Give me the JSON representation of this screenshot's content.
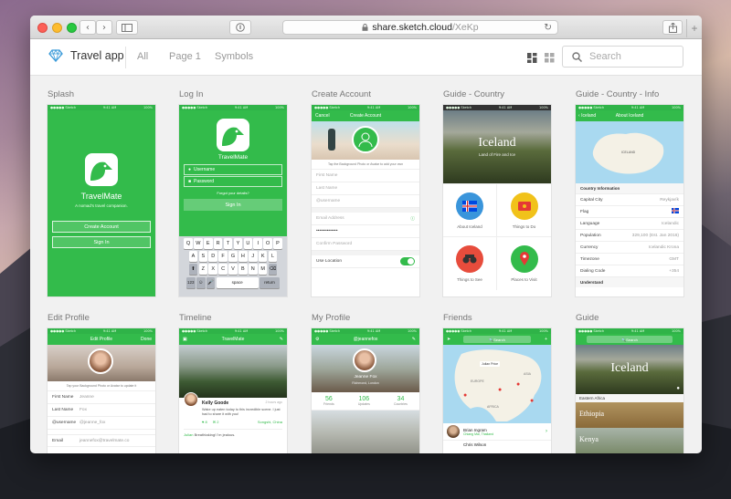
{
  "browser": {
    "url_host": "share.sketch.cloud",
    "url_path": "/XeKp",
    "back_icon": "chevron-left-icon",
    "forward_icon": "chevron-right-icon"
  },
  "app": {
    "title": "Travel app",
    "nav": [
      "All",
      "Page 1",
      "Symbols"
    ],
    "search_placeholder": "Search"
  },
  "artboards": {
    "splash": {
      "label": "Splash",
      "app_name": "TravelMate",
      "tagline": "A nomad's travel companion.",
      "create_account": "Create Account",
      "sign_in": "Sign In"
    },
    "login": {
      "label": "Log In",
      "app_name": "TravelMate",
      "username": "Username",
      "password": "Password",
      "forgot": "Forgot your details?",
      "sign_in": "Sign In",
      "kb_row1": [
        "Q",
        "W",
        "E",
        "R",
        "T",
        "Y",
        "U",
        "I",
        "O",
        "P"
      ],
      "kb_row2": [
        "A",
        "S",
        "D",
        "F",
        "G",
        "H",
        "J",
        "K",
        "L"
      ],
      "kb_row3": [
        "Z",
        "X",
        "C",
        "V",
        "B",
        "N",
        "M"
      ],
      "kb_123": "123",
      "kb_space": "space",
      "kb_return": "return"
    },
    "create": {
      "label": "Create Account",
      "cancel": "Cancel",
      "title": "Create Account",
      "hint": "Tap the Background Photo or Avatar to add your own",
      "first": "First Name",
      "last": "Last Name",
      "username": "@username",
      "email": "Email Address",
      "password": "••••••••••••••",
      "confirm": "Confirm Password",
      "location": "Use Location"
    },
    "guide_country": {
      "label": "Guide - Country",
      "title": "Iceland",
      "subtitle": "Land of Fire and Ice",
      "tiles": [
        "About Iceland",
        "Things to Do",
        "Things to See",
        "Places to Visit"
      ]
    },
    "guide_info": {
      "label": "Guide - Country - Info",
      "back": "Iceland",
      "title": "About Iceland",
      "map_label": "ICELAND",
      "section": "Country Information",
      "rows": [
        [
          "Capital City",
          "Reykjavík"
        ],
        [
          "Flag",
          ""
        ],
        [
          "Language",
          "Icelandic"
        ],
        [
          "Population",
          "329,100 (Est. Jan 2016)"
        ],
        [
          "Currency",
          "Icelandic Krona"
        ],
        [
          "Timezone",
          "GMT"
        ],
        [
          "Dialing Code",
          "+354"
        ]
      ],
      "footer": "Understand"
    },
    "edit_profile": {
      "label": "Edit Profile",
      "title": "Edit Profile",
      "done": "Done",
      "hint": "Tap your Background Photo or Avatar to update it",
      "rows": [
        [
          "First Name",
          "Jeanne"
        ],
        [
          "Last Name",
          "Fox"
        ],
        [
          "@username",
          "@jeanne_fox"
        ],
        [
          "Email",
          "jeannefox@travelmate.co"
        ]
      ]
    },
    "timeline": {
      "label": "Timeline",
      "title": "TravelMate",
      "user": "Kelly Goode",
      "time": "2 hours ago",
      "text": "Wake up eaten today to this incredible scene. I just had to share it with you!",
      "likes": "8",
      "comments": "2",
      "location": "Songshi, China",
      "second_user": "Julian",
      "second_text": "Breathtaking! I'm jealous."
    },
    "my_profile": {
      "label": "My Profile",
      "title": "@jeannefox",
      "name": "Jeanne Fox",
      "place": "Richmond, London",
      "stats": [
        [
          "56",
          "Friends"
        ],
        [
          "106",
          "Updates"
        ],
        [
          "34",
          "Countries"
        ]
      ]
    },
    "friends": {
      "label": "Friends",
      "search": "Search",
      "pin_name": "Julian Price",
      "map_words": [
        "ASIA",
        "EUROPE",
        "AFRICA"
      ],
      "friend1": "Brian Ingram",
      "friend1_place": "Chiang Mai, Thailand",
      "friend1_time": "3 hours ago",
      "friend2": "Chris Wilson"
    },
    "guide": {
      "label": "Guide",
      "search": "Search",
      "title": "Iceland",
      "regions": [
        "Eastern Africa",
        "Ethiopia",
        "Kenya"
      ]
    }
  },
  "colors": {
    "green": "#33bb4b",
    "green_dark": "#2fb348"
  }
}
